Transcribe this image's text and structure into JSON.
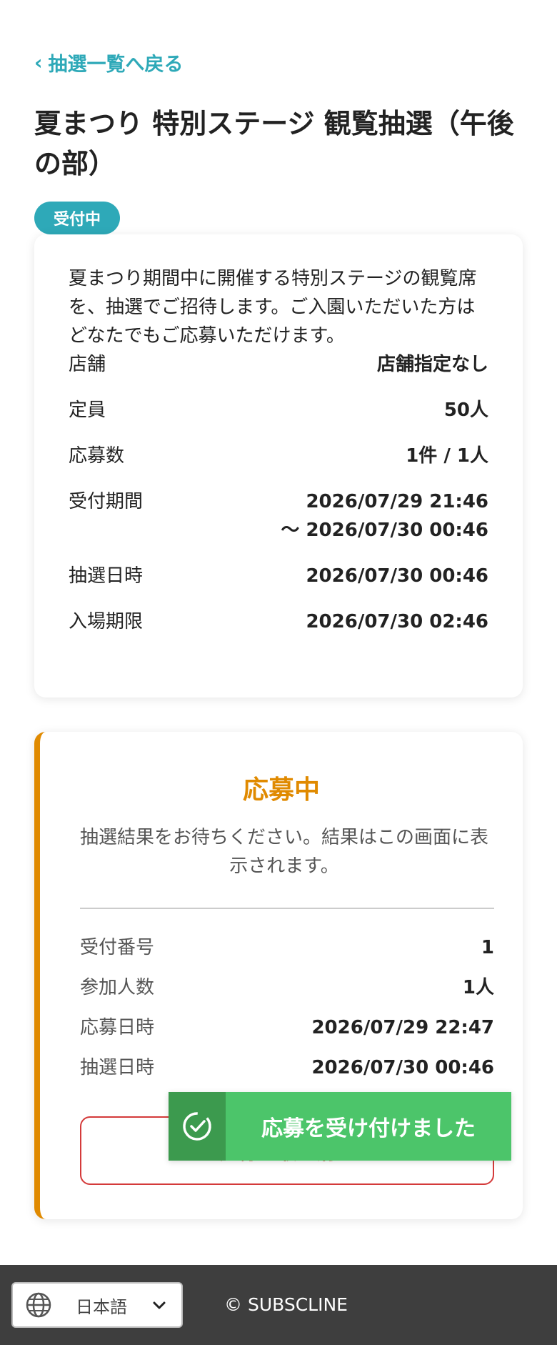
{
  "nav": {
    "back_label": "抽選一覧へ戻る",
    "back_icon": "chevron-left-icon"
  },
  "lottery": {
    "title": "夏まつり 特別ステージ 観覧抽選（午後の部）",
    "status_badge": "受付中",
    "description": "夏まつり期間中に開催する特別ステージの観覧席を、抽選でご招待します。ご入園いただいた方はどなたでもご応募いただけます。",
    "details": [
      {
        "label": "店舗",
        "value": "店舗指定なし"
      },
      {
        "label": "定員",
        "value": "50人"
      },
      {
        "label": "応募数",
        "value": "1件 / 1人"
      },
      {
        "label": "受付期間",
        "value": "2026/07/29 21:46",
        "value2": "〜 2026/07/30 00:46"
      },
      {
        "label": "抽選日時",
        "value": "2026/07/30 00:46"
      },
      {
        "label": "入場期限",
        "value": "2026/07/30 02:46"
      }
    ]
  },
  "entry": {
    "status_title": "応募中",
    "status_message": "抽選結果をお待ちください。結果はこの画面に表示されます。",
    "rows": [
      {
        "label": "受付番号",
        "value": "1"
      },
      {
        "label": "参加人数",
        "value": "1人"
      },
      {
        "label": "応募日時",
        "value": "2026/07/29 22:47"
      },
      {
        "label": "抽選日時",
        "value": "2026/07/30 00:46"
      }
    ],
    "cancel_button": "応募を取り消す"
  },
  "toast": {
    "message": "応募を受け付けました",
    "icon": "check-circle-icon"
  },
  "footer": {
    "language": "日本語",
    "language_icon": "globe-icon",
    "copyright": "© SUBSCLINE"
  },
  "colors": {
    "accent": "#2ea9b8",
    "pending": "#e08a00",
    "danger": "#d43a3a",
    "success": "#4cc56a",
    "success_dark": "#3c9a4e",
    "footer_bg": "#3e3e3e"
  }
}
